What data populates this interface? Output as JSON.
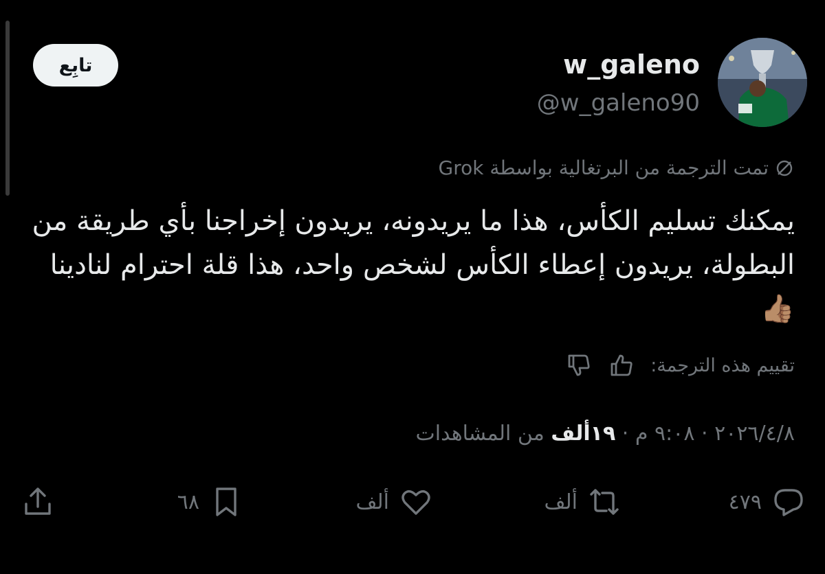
{
  "follow_button": {
    "label": "تابِع"
  },
  "user": {
    "display_name": "w_galeno",
    "handle": "@w_galeno90"
  },
  "translation_note": "تمت الترجمة من البرتغالية بواسطة Grok",
  "tweet": {
    "text": "يمكنك تسليم الكأس، هذا ما يريدونه، يريدون إخراجنا بأي طريقة من البطولة، يريدون إعطاء الكأس لشخص واحد، هذا قلة احترام لنادينا 👍🏽"
  },
  "rate_translation": {
    "label": "تقييم هذه الترجمة:"
  },
  "meta": {
    "date": "٢٠٢٦/٤/٨",
    "time": "٩:٠٨ م",
    "views_count": "١٩ألف",
    "views_label": "من المشاهدات"
  },
  "actions": {
    "replies": "٤٧٩",
    "reposts": "ألف",
    "likes": "ألف",
    "bookmarks": "٦٨"
  },
  "colors": {
    "background": "#000000",
    "primary_text": "#e7e9ea",
    "secondary_text": "#71767b",
    "follow_button_bg": "#eff3f4"
  }
}
